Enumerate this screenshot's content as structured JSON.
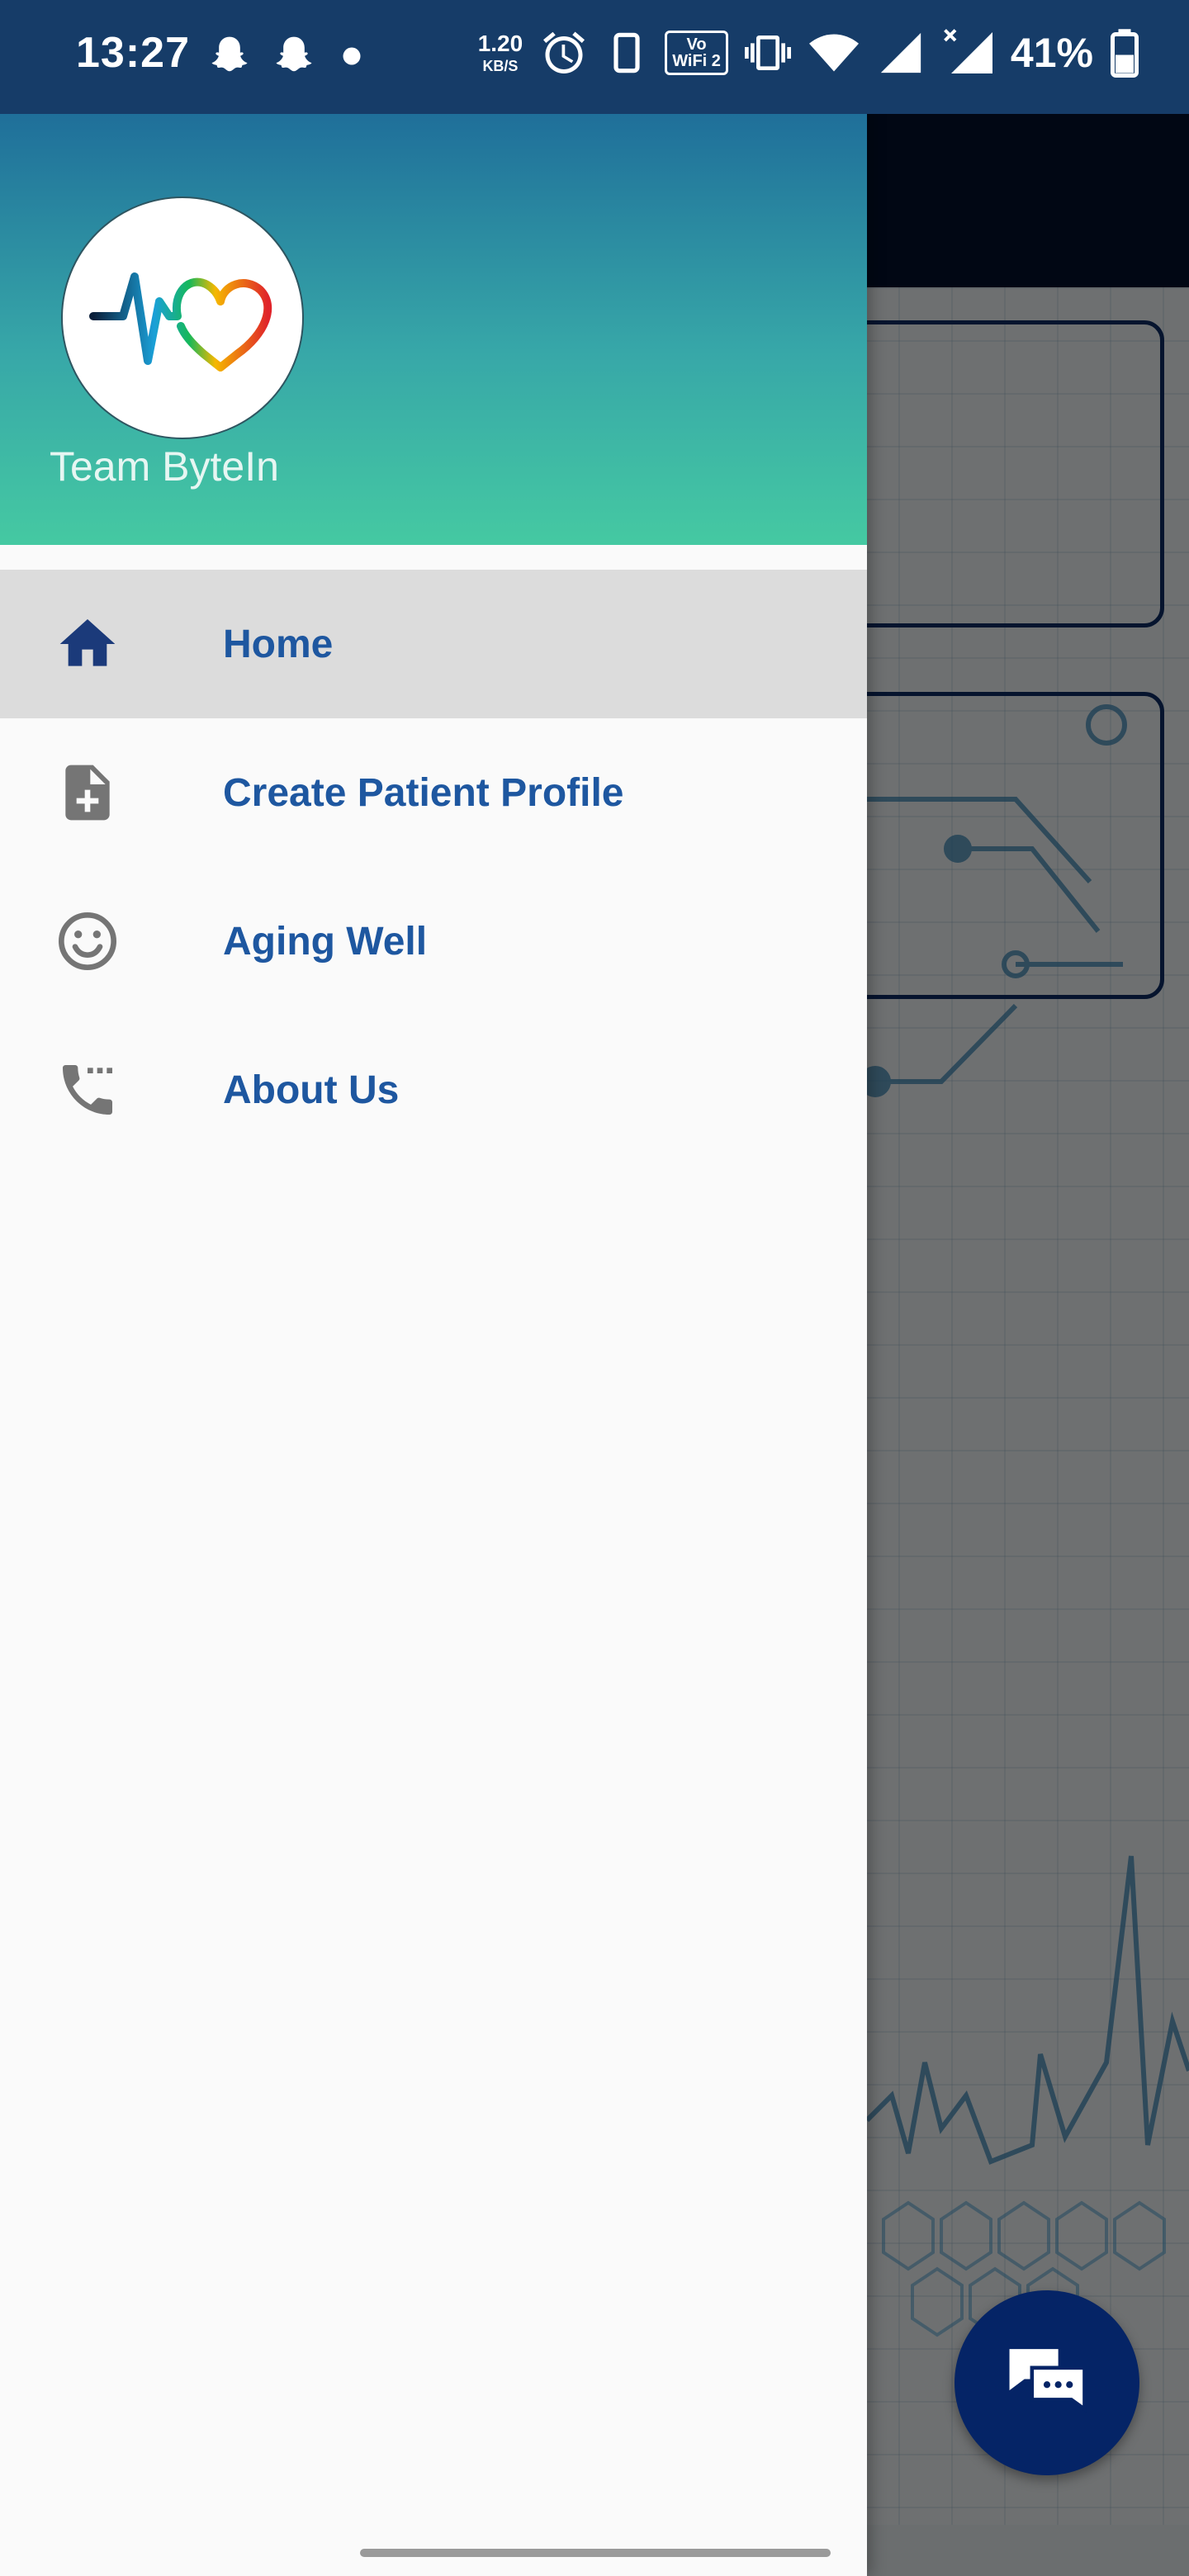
{
  "status_bar": {
    "time": "13:27",
    "net_speed_value": "1.20",
    "net_speed_unit": "KB/S",
    "volte_label_top": "Vo",
    "volte_label_bottom": "WiFi 2",
    "battery_percent": "41%",
    "icons": [
      "snapchat-icon",
      "snapchat-icon",
      "dot-icon",
      "alarm-icon",
      "phone-icon",
      "vibrate-icon",
      "wifi-icon",
      "signal-icon",
      "signal-no-data-icon",
      "battery-icon"
    ]
  },
  "drawer": {
    "header": {
      "team_name": "Team ByteIn",
      "logo_icon": "heartbeat-heart-logo"
    },
    "menu_items": [
      {
        "label": "Home",
        "icon": "home-icon",
        "active": true
      },
      {
        "label": "Create Patient Profile",
        "icon": "note-add-icon",
        "active": false
      },
      {
        "label": "Aging Well",
        "icon": "smiley-icon",
        "active": false
      },
      {
        "label": "About Us",
        "icon": "phone-dots-icon",
        "active": false
      }
    ]
  },
  "background_app": {
    "fab_icon": "chat-icon"
  },
  "colors": {
    "drawer_header_top": "#1f6f9a",
    "drawer_header_bottom": "#45c9a2",
    "menu_label": "#1e57a0",
    "home_icon": "#1b3a7a",
    "menu_icon_gray": "#757575",
    "active_item_bg": "#dcdcdc",
    "fab_bg": "#052466",
    "status_bar_bg": "#163c68",
    "app_toolbar": "#03112e"
  }
}
